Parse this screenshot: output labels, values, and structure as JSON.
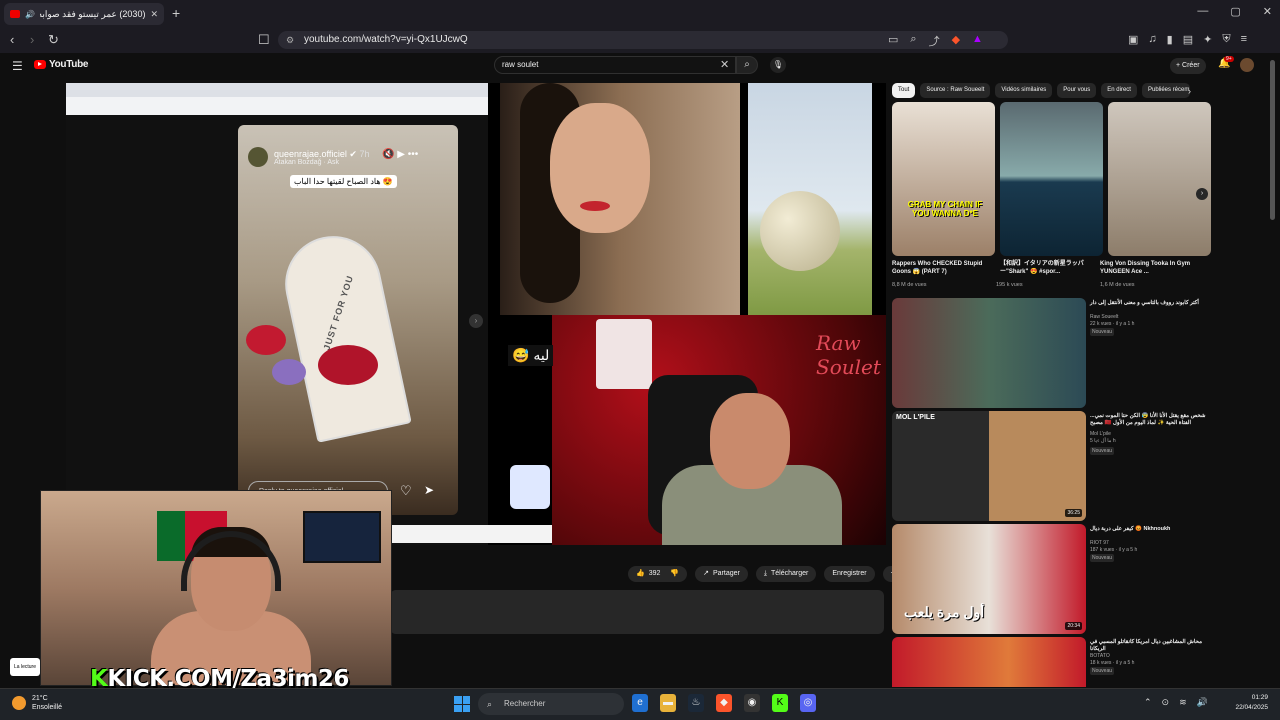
{
  "browser": {
    "tab_title": "(2030) عمر تيستو فقد صوابه ...",
    "new_tab": "+",
    "url": "youtube.com/watch?v=yi-Qx1UJcwQ",
    "window_controls": [
      "—",
      "▢",
      "✕"
    ]
  },
  "youtube": {
    "logo": "YouTube",
    "search_value": "raw soulet",
    "create_label": "Créer",
    "notification_count": "9+"
  },
  "video_overlay": {
    "ig_handle": "queenrajae.officiel",
    "ig_time": "7h",
    "ig_sub": "Atakan Bozdağ · Ask",
    "ig_caption": "هاد الصباح لقيتها حدا الباب 😍",
    "ig_panel_text": "JUST FOR YOU",
    "ig_reply": "Reply to queenrajae.officiel...",
    "arabic_sticker": "😅 ليه",
    "watermark": "Raw Soulet",
    "kick_k": "K",
    "kick_text": "KICK.COM/Za3im26"
  },
  "actions": {
    "likes": "392",
    "share": "Partager",
    "download": "Télécharger",
    "save": "Enregistrer"
  },
  "toast": "La lecture",
  "chips": [
    "Tout",
    "Source : Raw Soueelt",
    "Vidéos similaires",
    "Pour vous",
    "En direct",
    "Publiées récem"
  ],
  "shorts": [
    {
      "title": "Rappers Who CHECKED Stupid Goons 😱 (PART 7)",
      "views": "8,8 M de vues",
      "overlay": "GRAB MY CHAIN IF YOU WANNA D*E"
    },
    {
      "title": "【和訳】イタリアの新星ラッパー\"Shark\" 😍 #spor...",
      "views": "195 k vues",
      "overlay": ""
    },
    {
      "title": "King Von Dissing Tooka In Gym YUNGEEN Ace ...",
      "views": "1,6 M de vues",
      "overlay": ""
    }
  ],
  "recommendations": [
    {
      "title": "أكتر كابوند رووف بالتاسي و معنى الأنتقل إلى دار",
      "channel": "Raw Soueelt",
      "meta": "22 k vues · il y a 1 h",
      "badge": "Nouveau",
      "duration": ""
    },
    {
      "title": "شخص مقع يقتل الأنا الأنا 😰 الكن حتا الموت نمي... الفتاة الحية ✨ لماذ اليوم من الأول 🇲🇦 مصبح",
      "channel": "Mol L'pile",
      "meta": "ما أل ءيا 5 h",
      "badge": "Nouveau",
      "duration": "36:25",
      "thumb_label": "MOL L'PILE"
    },
    {
      "title": "Nkhnoukh 😡 كيفر على دربة ديال",
      "channel": "RIOT 97",
      "meta": "187 k vues · il y a 5 h",
      "badge": "Nouveau",
      "duration": "20:34",
      "thumb_label": "أول مرة يلعب"
    },
    {
      "title": "محاش المشاغبين ديال امريكا كانقاتلو المسبي في الريكانا",
      "channel": "BOTATO",
      "meta": "18 k vues · il y a 5 h",
      "badge": "Nouveau",
      "duration": ""
    }
  ],
  "taskbar": {
    "temp": "21°C",
    "weather": "Ensoleillé",
    "search": "Rechercher",
    "time": "01:29",
    "date": "22/04/2025"
  }
}
